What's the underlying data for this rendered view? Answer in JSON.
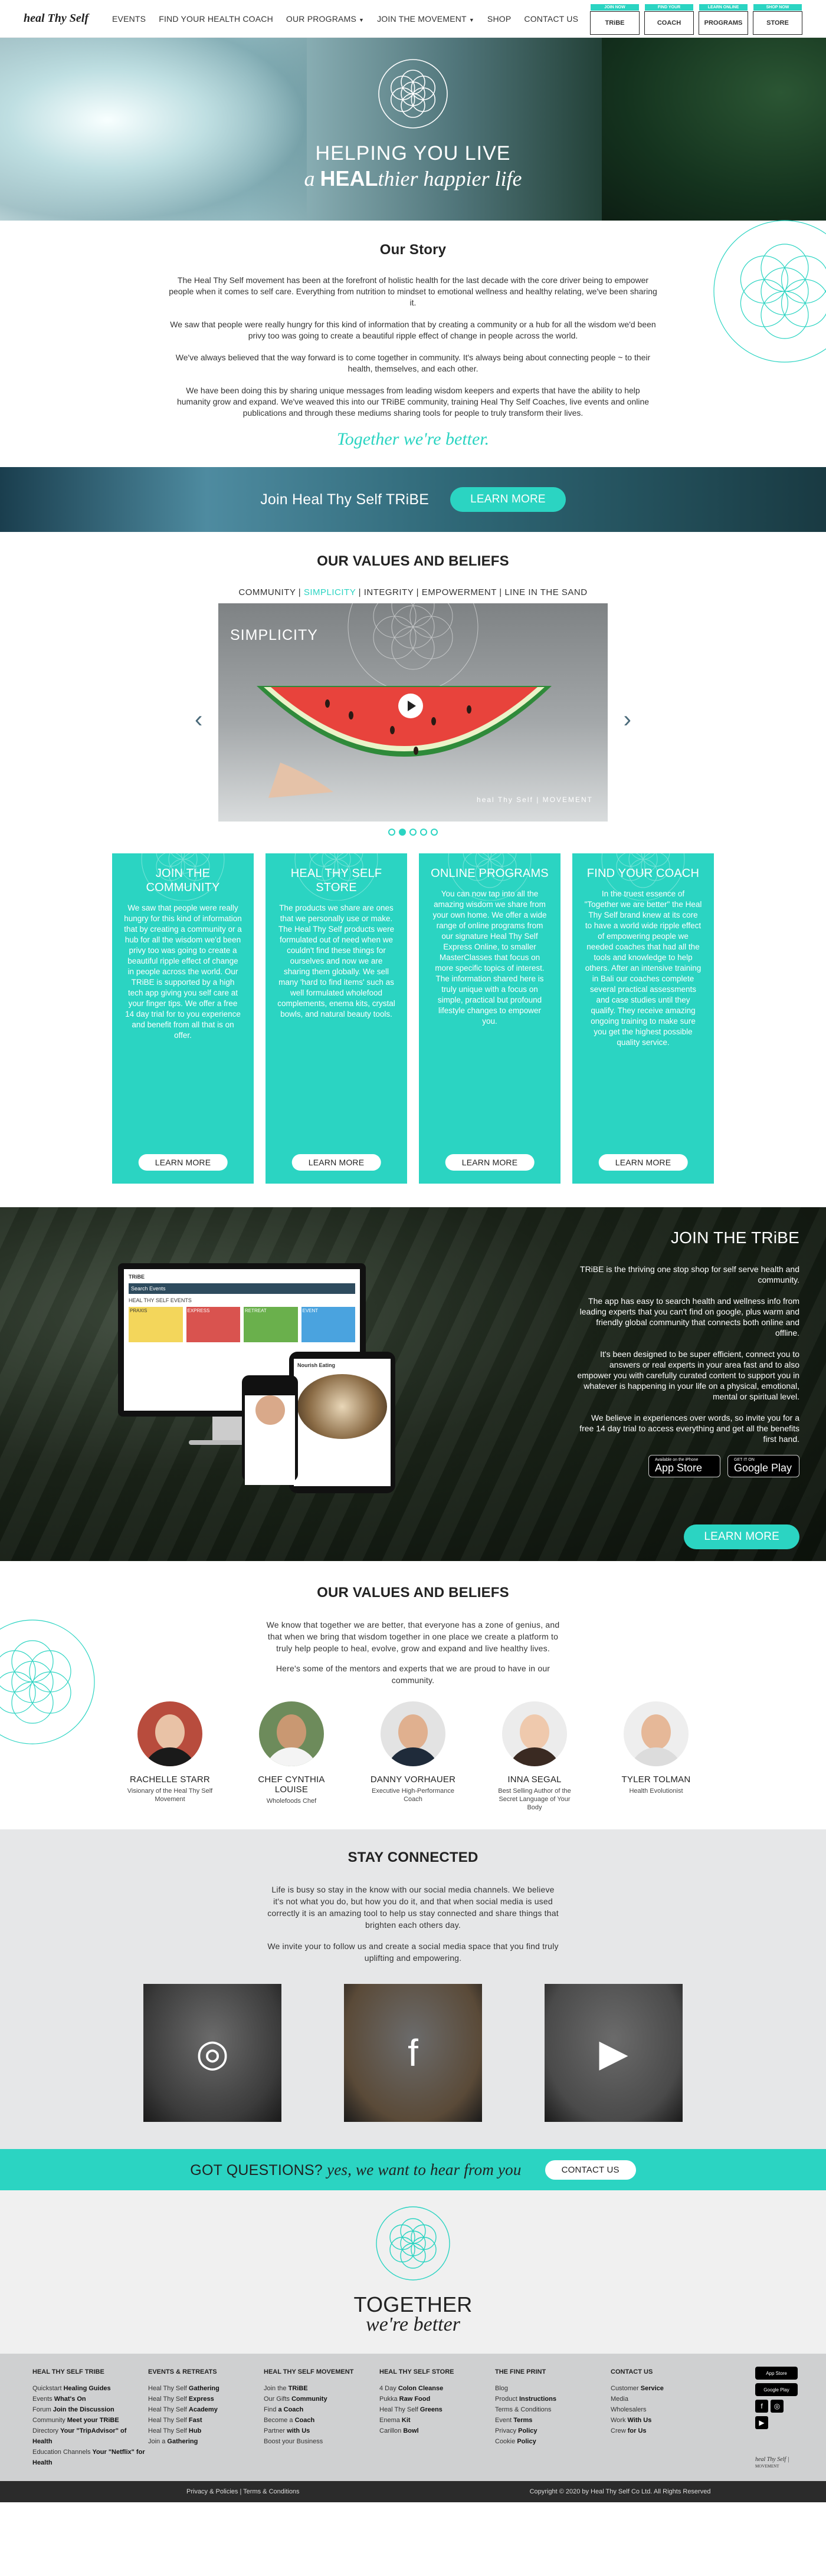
{
  "brand": {
    "logo": "heal Thy Self"
  },
  "nav": {
    "items": [
      "EVENTS",
      "FIND YOUR HEALTH COACH",
      "OUR PROGRAMS",
      "JOIN THE MOVEMENT",
      "SHOP",
      "CONTACT US"
    ],
    "shop_tabs": [
      {
        "tag": "JOIN NOW",
        "label": "TRiBE"
      },
      {
        "tag": "FIND YOUR",
        "label": "COACH"
      },
      {
        "tag": "LEARN ONLINE",
        "label": "PROGRAMS"
      },
      {
        "tag": "SHOP NOW",
        "label": "STORE"
      }
    ]
  },
  "hero": {
    "title": "HELPING YOU LIVE",
    "sub_a": "a",
    "sub_b": "HEAL",
    "sub_c": "thier happier life"
  },
  "story": {
    "heading": "Our Story",
    "paragraphs": [
      "The Heal Thy Self movement has been at the forefront of holistic health for the last decade with the core driver being to empower people when it comes to self care. Everything from nutrition to mindset to emotional wellness and healthy relating, we've been sharing it.",
      "We saw that people were really hungry for this kind of information that by creating a community or a hub for all the wisdom we'd been privy too was going to create a beautiful ripple effect of change in people across the world.",
      "We've always believed that the way forward is to come together in community. It's always being about connecting people ~ to their health, themselves, and each other.",
      "We have been doing this by sharing unique messages from leading wisdom keepers and experts that have the ability to help humanity grow and expand. We've weaved this into our TRiBE community, training Heal Thy Self Coaches, live events and online publications and through these mediums sharing tools for people to truly transform their lives."
    ],
    "tagline": "Together we're better."
  },
  "join_band": {
    "text": "Join Heal Thy Self TRiBE",
    "button": "LEARN MORE"
  },
  "values": {
    "heading": "OUR VALUES AND BELIEFS",
    "tabs": [
      "COMMUNITY",
      "SIMPLICITY",
      "INTEGRITY",
      "EMPOWERMENT",
      "LINE IN THE SAND"
    ],
    "sep": "|",
    "active_tab": "SIMPLICITY",
    "slide_label": "SIMPLICITY",
    "slide_brand": "MOVEMENT",
    "slide_brand_logo": "heal Thy Self",
    "arrow_left": "‹",
    "arrow_right": "›",
    "slides_count": 5,
    "active_slide": 1
  },
  "cards": [
    {
      "title": "JOIN THE COMMUNITY",
      "body": "We saw that people were really hungry for this kind of information that by creating a community or a hub for all the wisdom we'd been privy too was going to create a beautiful ripple effect of change in people across the world. Our TRiBE is supported by a high tech app giving you self care at your finger tips. We offer a free 14 day trial for to you experience and benefit from all that is on offer.",
      "button": "LEARN MORE"
    },
    {
      "title": "HEAL THY SELF STORE",
      "body": "The products we share are ones that we personally use or make. The Heal Thy Self products were formulated out of need when we couldn't find these things for ourselves and now we are sharing them globally. We sell many 'hard to find items' such as well formulated wholefood complements, enema kits, crystal bowls, and natural beauty tools.",
      "button": "LEARN MORE"
    },
    {
      "title": "ONLINE PROGRAMS",
      "body": "You can now tap into all the amazing wisdom we share from your own home. We offer a wide range of online programs from our signature Heal Thy Self Express Online, to smaller MasterClasses that focus on more specific topics of interest. The information shared here is truly unique with a focus on simple, practical but profound lifestyle changes to empower you.",
      "button": "LEARN MORE"
    },
    {
      "title": "FIND YOUR COACH",
      "body": "In the truest essence of \"Together we are better\" the Heal Thy Self brand knew at its core to have a world wide ripple effect of empowering people we needed coaches that had all the tools and knowledge to help others. After an intensive training in Bali our coaches complete several practical assessments and case studies until they qualify. They receive amazing ongoing training to make sure you get the highest possible quality service.",
      "button": "LEARN MORE"
    }
  ],
  "tribe": {
    "heading": "JOIN THE TRiBE",
    "paragraphs": [
      "TRiBE is the thriving one stop shop for self serve health and community.",
      "The app has easy to search health and wellness info from leading experts that you can't find on google, plus warm and friendly global community that connects both online and offline.",
      "It's been designed to be super efficient, connect you to answers or real experts in your area fast and to also empower you with carefully curated content to support you in whatever is happening in your life on a physical, emotional, mental or spiritual level.",
      "We believe in experiences over words, so invite you for a free 14 day trial to access everything and get all the benefits first hand."
    ],
    "app_store_small": "Available on the iPhone",
    "app_store": "App Store",
    "play_small": "GET IT ON",
    "play": "Google Play",
    "button": "LEARN MORE",
    "mock_logo": "TRiBE",
    "mock_search": "Search Events",
    "mock_events": "HEAL THY SELF EVENTS",
    "mock_tiles": [
      "PRAXIS",
      "EXPRESS",
      "RETREAT",
      "EVENT"
    ],
    "mock_tablet_title": "Nourish Eating"
  },
  "mentors": {
    "heading": "OUR VALUES AND BELIEFS",
    "intro": "We know that together we are better, that everyone has a zone of genius, and that when we bring that wisdom together in one place we create a platform to truly help people to heal, evolve, grow and expand and live healthy lives.",
    "intro2": "Here's some of the mentors and experts that we are proud to have in our community.",
    "people": [
      {
        "name": "RACHELLE STARR",
        "role": "Visionary of the Heal Thy Self Movement",
        "bg": "#b84c3d",
        "skin": "#e9c2a6",
        "top": "#1a1a1a"
      },
      {
        "name": "CHEF CYNTHIA LOUISE",
        "role": "Wholefoods Chef",
        "bg": "#6d8b5b",
        "skin": "#c99872",
        "top": "#f4f4f4"
      },
      {
        "name": "DANNY VORHAUER",
        "role": "Executive High-Performance Coach",
        "bg": "#e3e3e3",
        "skin": "#e0b08f",
        "top": "#1f2b3a"
      },
      {
        "name": "INNA SEGAL",
        "role": "Best Selling Author of the Secret Language of Your Body",
        "bg": "#ececec",
        "skin": "#efc9ad",
        "top": "#3a2a22"
      },
      {
        "name": "TYLER TOLMAN",
        "role": "Health Evolutionist",
        "bg": "#eeeeee",
        "skin": "#e6b898",
        "top": "#dcdcdc"
      }
    ]
  },
  "stay": {
    "heading": "STAY CONNECTED",
    "p1": "Life is busy so stay in the know with our social media channels. We believe it's not what you do, but how you do it, and that when social media is used correctly it is an amazing tool to help us stay connected and share things that brighten each others day.",
    "p2": "We invite your to follow us and create a social media space that you find truly uplifting and empowering.",
    "social": [
      {
        "name": "instagram",
        "glyph": "◎",
        "bg": "#3b3b3b"
      },
      {
        "name": "facebook",
        "glyph": "f",
        "bg": "#5a4a38"
      },
      {
        "name": "youtube",
        "glyph": "▶",
        "bg": "#4a4a4a"
      }
    ]
  },
  "questions": {
    "text": "GOT QUESTIONS?",
    "italic": "yes, we want to hear from you",
    "button": "CONTACT US"
  },
  "together": {
    "line1": "TOGETHER",
    "line2": "we're better"
  },
  "footer": {
    "cols": [
      {
        "title": "HEAL THY SELF TRIBE",
        "items": [
          [
            "Quickstart",
            "Healing Guides"
          ],
          [
            "Events",
            "What's On"
          ],
          [
            "Forum",
            "Join the Discussion"
          ],
          [
            "Community",
            "Meet your TRiBE"
          ],
          [
            "Directory",
            "Your \"TripAdvisor\" of Health"
          ],
          [
            "Education Channels",
            "Your \"Netflix\" for Health"
          ]
        ]
      },
      {
        "title": "EVENTS & RETREATS",
        "items": [
          [
            "Heal Thy Self",
            "Gathering"
          ],
          [
            "Heal Thy Self",
            "Express"
          ],
          [
            "Heal Thy Self",
            "Academy"
          ],
          [
            "Heal Thy Self",
            "Fast"
          ],
          [
            "Heal Thy Self",
            "Hub"
          ],
          [
            "Join a",
            "Gathering"
          ]
        ]
      },
      {
        "title": "HEAL THY SELF MOVEMENT",
        "items": [
          [
            "Join the",
            "TRiBE"
          ],
          [
            "Our Gifts",
            "Community"
          ],
          [
            "Find",
            "a Coach"
          ],
          [
            "Become a",
            "Coach"
          ],
          [
            "Partner",
            "with Us"
          ],
          [
            "Boost your Business",
            ""
          ]
        ]
      },
      {
        "title": "HEAL THY SELF STORE",
        "items": [
          [
            "4 Day",
            "Colon Cleanse"
          ],
          [
            "Pukka",
            "Raw Food"
          ],
          [
            "Heal Thy Self",
            "Greens"
          ],
          [
            "Enema",
            "Kit"
          ],
          [
            "Carillon",
            "Bowl"
          ]
        ]
      },
      {
        "title": "THE FINE PRINT",
        "items": [
          [
            "Blog",
            ""
          ],
          [
            "Product",
            "Instructions"
          ],
          [
            "Terms & Conditions",
            ""
          ],
          [
            "Event",
            "Terms"
          ],
          [
            "Privacy",
            "Policy"
          ],
          [
            "Cookie",
            "Policy"
          ]
        ]
      },
      {
        "title": "CONTACT US",
        "items": [
          [
            "Customer",
            "Service"
          ],
          [
            "Media",
            ""
          ],
          [
            "Wholesalers",
            ""
          ],
          [
            "Work",
            "With Us"
          ],
          [
            "Crew",
            "for Us"
          ]
        ]
      }
    ],
    "app_badge_1": "App Store",
    "app_badge_2": "Google Play",
    "social_icons": [
      "f",
      "◎",
      "▶"
    ],
    "footer_logo": "heal Thy Self",
    "footer_logo_sub": "MOVEMENT",
    "bottom_links": "Privacy & Policies | Terms & Conditions",
    "copyright": "Copyright © 2020 by Heal Thy Self Co Ltd. All Rights Reserved"
  },
  "colors": {
    "accent": "#2bd4c2",
    "dark_footer": "#2b2b2b",
    "light_footer": "#cfd0d1"
  },
  "icons": [
    "chevron-down-icon",
    "flower-of-life-icon",
    "play-icon",
    "instagram-icon",
    "facebook-icon",
    "youtube-icon"
  ]
}
